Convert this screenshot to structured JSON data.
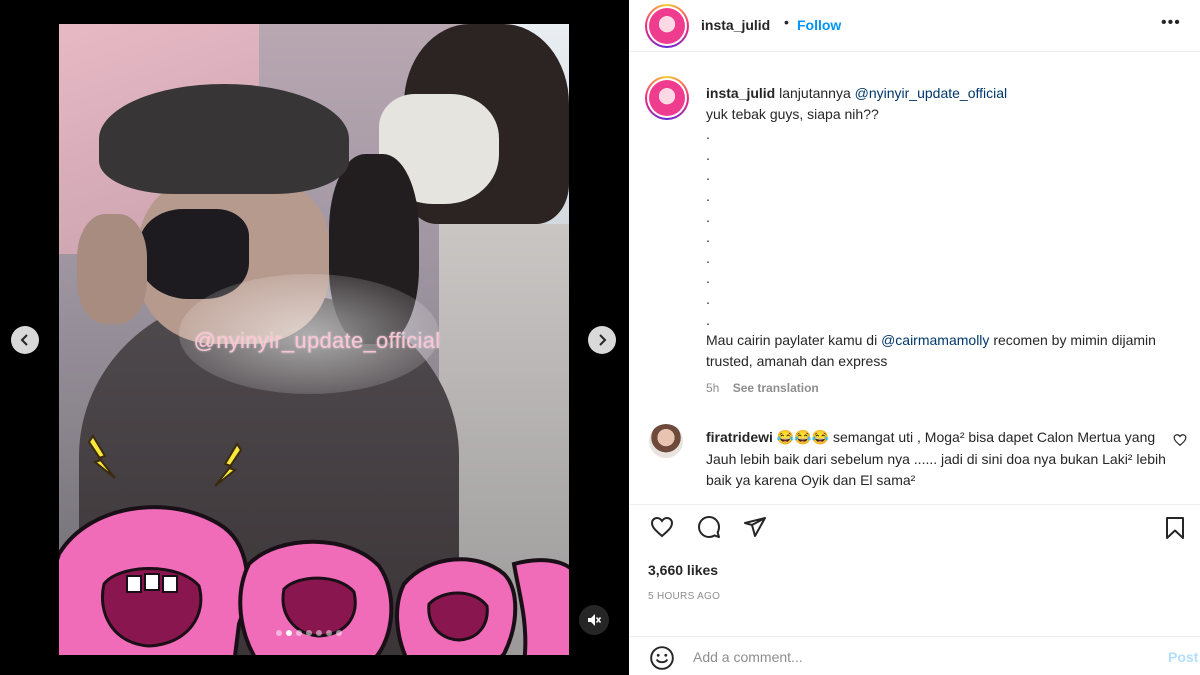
{
  "post": {
    "username": "insta_julid",
    "separator": "•",
    "follow_label": "Follow",
    "more_label": "•••"
  },
  "media": {
    "watermark": "@nyinyir_update_official",
    "dots_total": 7,
    "dots_active_index": 1
  },
  "caption": {
    "username": "insta_julid",
    "text_lead": "lanjutannya",
    "mention": "@nyinyir_update_official",
    "line2": "yuk tebak guys, siapa nih??",
    "dot_lines": [
      ".",
      ".",
      ".",
      ".",
      ".",
      ".",
      ".",
      ".",
      ".",
      "."
    ],
    "promo_before": "Mau cairin paylater kamu di",
    "promo_mention": "@cairmamamolly",
    "promo_after": "recomen by mimin dijamin trusted, amanah dan express",
    "age": "5h",
    "see_translation": "See translation"
  },
  "comment": {
    "username": "firatridewi",
    "emojis": "😂😂😂",
    "text": "semangat uti , Moga² bisa dapet Calon Mertua yang Jauh lebih baik dari sebelum nya ...... jadi di sini doa nya bukan Laki² lebih baik ya karena Oyik dan El sama²"
  },
  "stats": {
    "likes": "3,660 likes",
    "time": "5 HOURS AGO"
  },
  "add_comment": {
    "placeholder": "Add a comment...",
    "post_label": "Post"
  },
  "colors": {
    "accent": "#0095f6",
    "mention": "#00376b",
    "post_disabled": "#b2dffc",
    "sticker_pink": "#f06bb8"
  }
}
